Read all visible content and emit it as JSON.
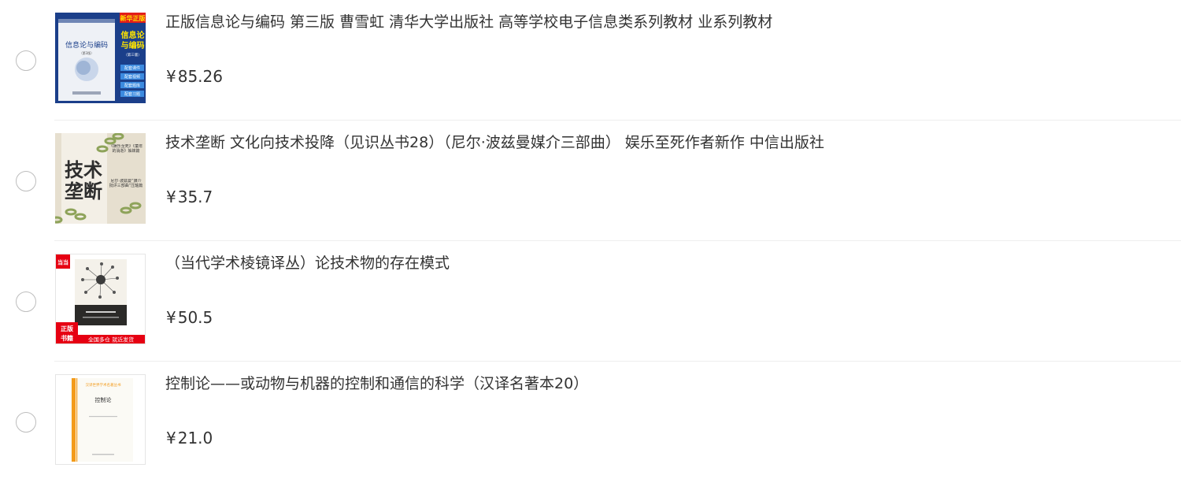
{
  "products": [
    {
      "title": "正版信息论与编码 第三版 曹雪虹 清华大学出版社 高等学校电子信息类系列教材 业系列教材",
      "currency": "¥",
      "price": "85.26",
      "cover": {
        "badge": "新华正版",
        "side_title_line1": "信息论",
        "side_title_line2": "与编码",
        "book_title": "信息论与编码",
        "edition": "（第3版）",
        "edition_side": "（第三版）",
        "tags": [
          "配套课件",
          "配套视频",
          "配套题库",
          "配套习题"
        ],
        "colors": {
          "bg": "#1b3f8a",
          "front": "#eef1f6",
          "badge": "#e31d1a",
          "badge_text": "#ffe400",
          "side_title": "#ffe400"
        }
      }
    },
    {
      "title": "技术垄断 文化向技术投降（见识丛书28）（尼尔·波兹曼媒介三部曲） 娱乐至死作者新作 中信出版社",
      "currency": "¥",
      "price": "35.7",
      "cover": {
        "big_title_line1": "技术",
        "big_title_line2": "垄断",
        "note1": "《娱乐至死》《童年的消逝》姊妹篇",
        "note2": "尼尔·波兹曼“媒介批评三部曲”压轴篇",
        "colors": {
          "bg": "#e6dfcf",
          "chain": "#8ea35a",
          "title": "#2d2d2d"
        }
      }
    },
    {
      "title": "（当代学术棱镜译丛）论技术物的存在模式",
      "currency": "¥",
      "price": "50.5",
      "cover": {
        "logo": "当当",
        "badge_line1": "正版",
        "badge_line2": "书籍",
        "banner": "全国多仓 就近发货",
        "colors": {
          "red": "#e60012",
          "book": "#f4f1ea",
          "band": "#2b2a28"
        }
      }
    },
    {
      "title": "控制论——或动物与机器的控制和通信的科学（汉译名著本20）",
      "currency": "¥",
      "price": "21.0",
      "cover": {
        "series": "汉译世界学术名著丛书",
        "book_title": "控制论",
        "colors": {
          "spine": "#f39b1b",
          "bg": "#fbfaf5"
        }
      }
    }
  ]
}
